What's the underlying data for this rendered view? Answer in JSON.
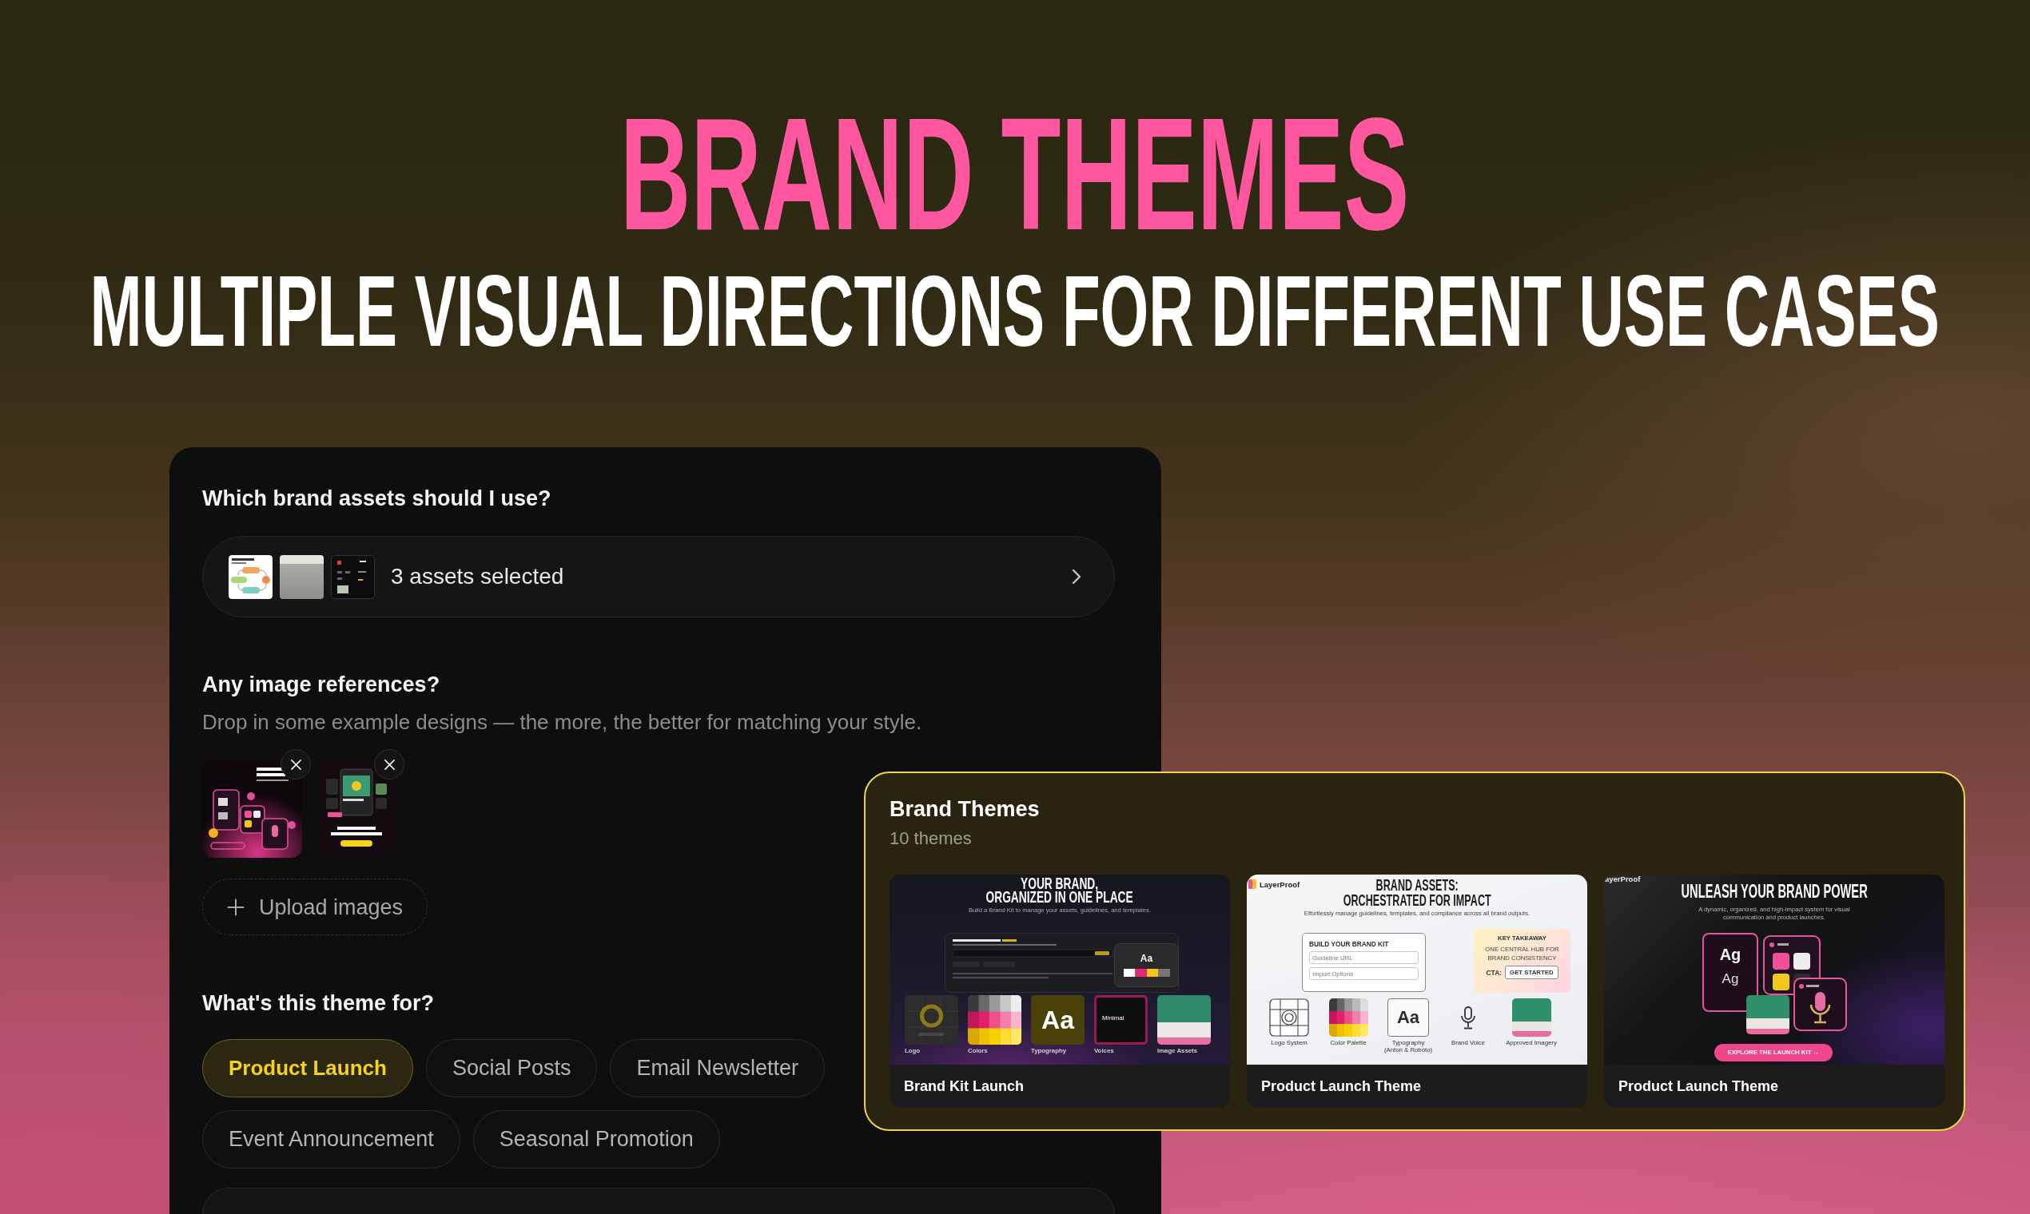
{
  "hero": {
    "title": "BRAND THEMES",
    "subtitle": "MULTIPLE VISUAL DIRECTIONS FOR DIFFERENT USE CASES"
  },
  "form": {
    "assets": {
      "question": "Which brand assets should I use?",
      "thumbnails": [
        {
          "kind": "diagram"
        },
        {
          "kind": "photo"
        },
        {
          "kind": "screen"
        }
      ],
      "summary": "3 assets selected"
    },
    "references": {
      "question": "Any image references?",
      "hint": "Drop in some example designs — the more, the better for matching your style.",
      "images": [
        {
          "kind": "glow_cards"
        },
        {
          "kind": "phone_cards"
        }
      ],
      "upload_label": "Upload images"
    },
    "purpose": {
      "question": "What's this theme for?",
      "options": [
        {
          "label": "Product Launch",
          "selected": true
        },
        {
          "label": "Social Posts",
          "selected": false
        },
        {
          "label": "Email Newsletter",
          "selected": false
        },
        {
          "label": "Event Announcement",
          "selected": false
        },
        {
          "label": "Seasonal Promotion",
          "selected": false
        }
      ]
    }
  },
  "themes_panel": {
    "title": "Brand Themes",
    "count": "10 themes",
    "themes": [
      {
        "name": "Brand Kit Launch",
        "preview": {
          "kind": "brand_kit",
          "headline": [
            "YOUR BRAND,",
            "ORGANIZED IN ONE PLACE"
          ],
          "subtitle": "Build a Brand Kit to manage your assets, guidelines, and templates.",
          "sample": "Aa",
          "tiles": [
            {
              "kind": "logo",
              "label": "Logo"
            },
            {
              "kind": "colors",
              "label": "Colors"
            },
            {
              "kind": "type",
              "label": "Typography",
              "text": "Aa"
            },
            {
              "kind": "voice",
              "label": "Voices",
              "text": "Minimal"
            },
            {
              "kind": "image",
              "label": "Image Assets"
            }
          ]
        }
      },
      {
        "name": "Product Launch Theme",
        "preview": {
          "kind": "light_kit",
          "logo": "LayerProof",
          "headline": [
            "BRAND ASSETS:",
            "ORCHESTRATED FOR IMPACT"
          ],
          "subtitle": "Effortlessly manage guidelines, templates, and compliance across all brand outputs.",
          "form": {
            "title": "BUILD YOUR BRAND KIT",
            "fields": [
              {
                "placeholder": "Guideline URL"
              },
              {
                "placeholder": "Import Options"
              }
            ]
          },
          "takeaway": {
            "label": "KEY TAKEAWAY",
            "message": [
              "ONE CENTRAL HUB FOR",
              "BRAND CONSISTENCY"
            ],
            "cta_label": "CTA:",
            "cta_button": "GET STARTED"
          },
          "items": [
            {
              "kind": "logo",
              "lines": [
                "Logo System"
              ]
            },
            {
              "kind": "palette",
              "lines": [
                "Color Palette"
              ]
            },
            {
              "kind": "type",
              "text": "Aa",
              "lines": [
                "Typography",
                "(Anton & Roboto)"
              ]
            },
            {
              "kind": "voice",
              "lines": [
                "Brand Voice"
              ]
            },
            {
              "kind": "image",
              "lines": [
                "Approved Imagery"
              ]
            }
          ]
        }
      },
      {
        "name": "Product Launch Theme",
        "preview": {
          "kind": "glass_cards",
          "logo": "ayerProof",
          "headline": [
            "UNLEASH YOUR BRAND POWER"
          ],
          "subtitle": [
            "A dynamic, organized, and high-impact system for visual",
            "communication and product launches."
          ],
          "type_samples": [
            "Ag",
            "Ag"
          ],
          "button": "EXPLORE THE LAUNCH KIT →"
        }
      }
    ]
  }
}
